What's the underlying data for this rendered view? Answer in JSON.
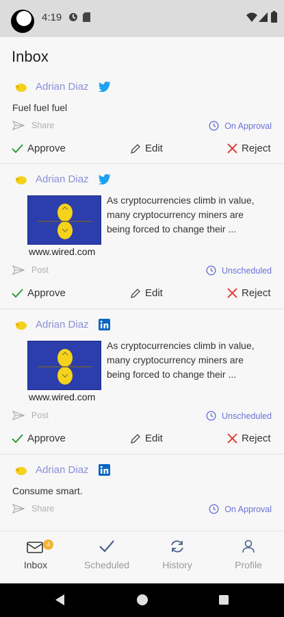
{
  "status_bar": {
    "time": "4:19"
  },
  "page": {
    "title": "Inbox"
  },
  "posts": [
    {
      "author": "Adrian Diaz",
      "network": "twitter",
      "text": "Fuel fuel fuel",
      "share_label": "Share",
      "status": "On Approval",
      "actions": {
        "approve": "Approve",
        "edit": "Edit",
        "reject": "Reject"
      }
    },
    {
      "author": "Adrian Diaz",
      "network": "twitter",
      "link": {
        "domain": "www.wired.com",
        "snippet": "As cryptocurrencies climb in value, many cryptocurrency miners are being forced to change their ..."
      },
      "share_label": "Post",
      "status": "Unscheduled",
      "actions": {
        "approve": "Approve",
        "edit": "Edit",
        "reject": "Reject"
      }
    },
    {
      "author": "Adrian Diaz",
      "network": "linkedin",
      "link": {
        "domain": "www.wired.com",
        "snippet": "As cryptocurrencies climb in value, many cryptocurrency miners are being forced to change their ..."
      },
      "share_label": "Post",
      "status": "Unscheduled",
      "actions": {
        "approve": "Approve",
        "edit": "Edit",
        "reject": "Reject"
      }
    },
    {
      "author": "Adrian Diaz",
      "network": "linkedin",
      "text": "Consume smart.",
      "share_label": "Share",
      "status": "On Approval"
    }
  ],
  "bottom_nav": {
    "items": [
      {
        "label": "Inbox",
        "icon": "inbox-icon",
        "badge": "4"
      },
      {
        "label": "Scheduled",
        "icon": "checkmark-icon"
      },
      {
        "label": "History",
        "icon": "refresh-icon"
      },
      {
        "label": "Profile",
        "icon": "person-icon"
      }
    ]
  },
  "colors": {
    "accent": "#6a72d8",
    "author": "#8a8fd6",
    "approve": "#2e9e3b",
    "reject": "#e0413a",
    "twitter": "#1da1f2",
    "linkedin": "#0a66c2",
    "badge": "#f2b233"
  }
}
